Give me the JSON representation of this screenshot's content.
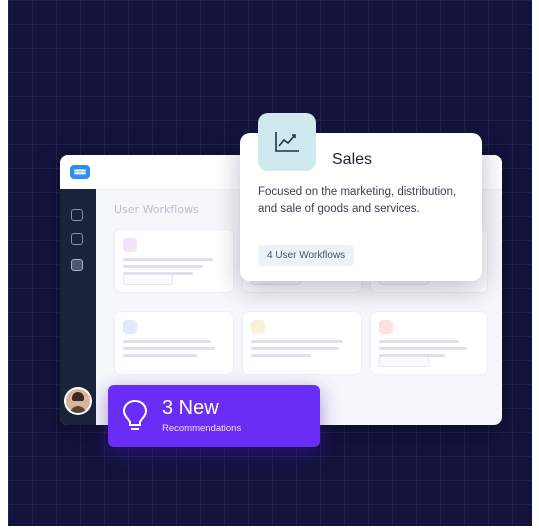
{
  "main": {
    "section_title": "User Workflows"
  },
  "sales_card": {
    "icon": "line-chart-icon",
    "title": "Sales",
    "description": "Focused on the marketing, distribution, and sale of goods and services.",
    "workflows_label": "4 User Workflows"
  },
  "recommendations": {
    "icon": "lightbulb-icon",
    "count_label": "3 New",
    "label": "Recommendations"
  },
  "colors": {
    "background": "#13133d",
    "accent_purple": "#6a2df5",
    "sidebar": "#19243a",
    "sales_icon_bg": "#cfe9ee",
    "logo_blue": "#2f8cf0"
  }
}
